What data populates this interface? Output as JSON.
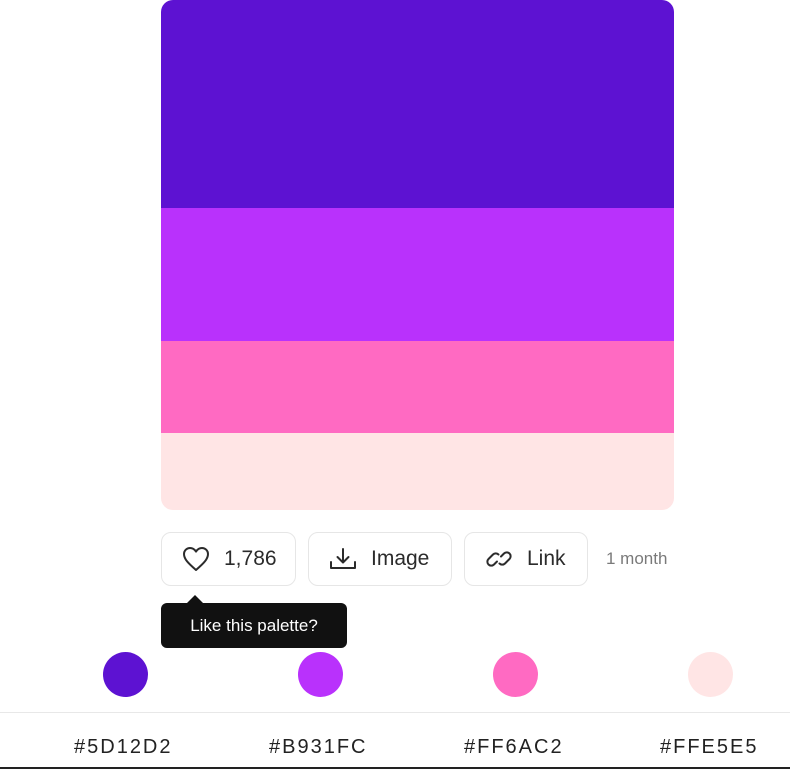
{
  "palette": {
    "colors": [
      "#5D12D2",
      "#B931FC",
      "#FF6AC2",
      "#FFE5E5"
    ]
  },
  "actions": {
    "like_count": "1,786",
    "image_label": "Image",
    "link_label": "Link",
    "age": "1 month"
  },
  "tooltip": {
    "text": "Like this palette?"
  },
  "swatches": [
    {
      "hex": "#5D12D2",
      "color": "#5D12D2"
    },
    {
      "hex": "#B931FC",
      "color": "#B931FC"
    },
    {
      "hex": "#FF6AC2",
      "color": "#FF6AC2"
    },
    {
      "hex": "#FFE5E5",
      "color": "#FFE5E5"
    }
  ],
  "icons": {
    "like": "heart-icon",
    "image": "download-icon",
    "link": "link-icon"
  }
}
